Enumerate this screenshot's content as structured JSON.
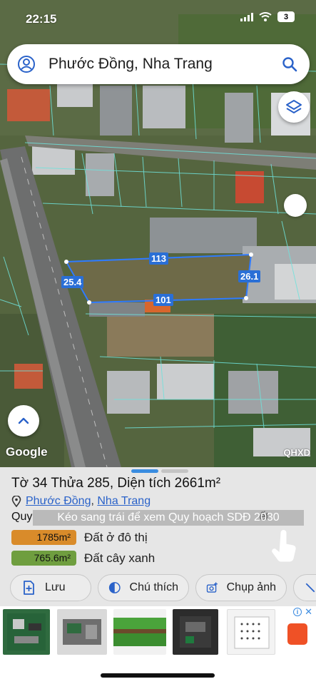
{
  "status_bar": {
    "time": "22:15",
    "battery": "3"
  },
  "search": {
    "query": "Phước Đồng, Nha Trang"
  },
  "map": {
    "dimensions": [
      "113",
      "25.4",
      "26.1",
      "101"
    ],
    "google_logo": "Google",
    "code": "QHXD",
    "parcel_outline_color": "#2f7bff",
    "boundary_color": "#6fe3dc"
  },
  "parcel": {
    "title": "Tờ 34 Thửa 285, Diện tích 2661m²",
    "ward": "Phước Đồng",
    "separator": ",",
    "city": "Nha Trang",
    "plan_label": "Quy",
    "plan_suffix": "ết",
    "swipe_hint": "Kéo sang trái để xem Quy hoạch SDĐ 2030"
  },
  "land_use": [
    {
      "area": "1785m²",
      "label": "Đất ở đô thị",
      "color": "#d98b2a"
    },
    {
      "area": "765.6m²",
      "label": "Đất cây xanh",
      "color": "#6f9e3f"
    }
  ],
  "actions": [
    {
      "icon": "add-document-icon",
      "label": "Lưu"
    },
    {
      "icon": "half-circle-icon",
      "label": "Chú thích"
    },
    {
      "icon": "add-photo-icon",
      "label": "Chụp ảnh"
    }
  ],
  "ads": {
    "info": "i",
    "close": "✕"
  }
}
